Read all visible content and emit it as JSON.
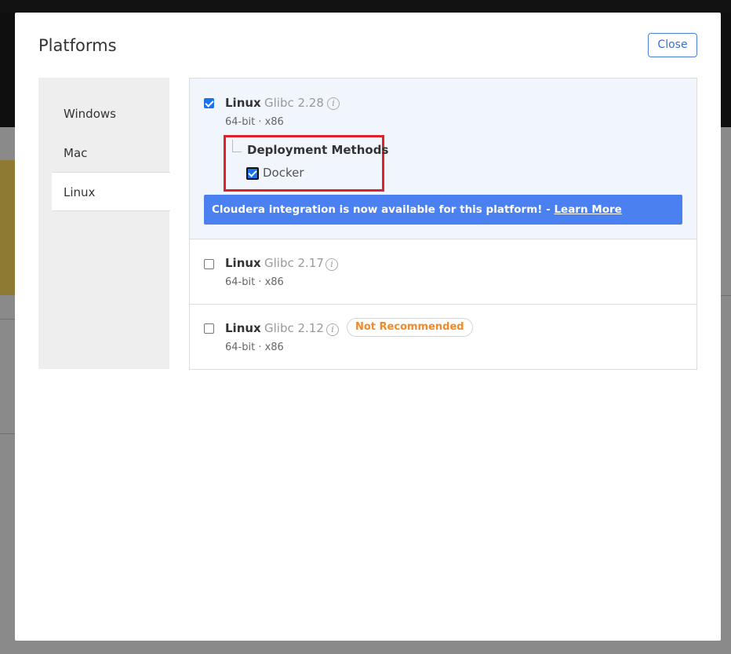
{
  "modal": {
    "title": "Platforms",
    "close_label": "Close"
  },
  "sidebar": {
    "items": [
      {
        "label": "Windows",
        "active": false
      },
      {
        "label": "Mac",
        "active": false
      },
      {
        "label": "Linux",
        "active": true
      }
    ]
  },
  "platforms": [
    {
      "name": "Linux",
      "version": "Glibc 2.28",
      "arch": "64-bit · x86",
      "checked": true,
      "deployment": {
        "title": "Deployment Methods",
        "methods": [
          {
            "label": "Docker",
            "checked": true
          }
        ]
      },
      "banner": {
        "text": "Cloudera integration is now available for this platform! - ",
        "link": "Learn More"
      }
    },
    {
      "name": "Linux",
      "version": "Glibc 2.17",
      "arch": "64-bit · x86",
      "checked": false
    },
    {
      "name": "Linux",
      "version": "Glibc 2.12",
      "arch": "64-bit · x86",
      "checked": false,
      "badge": "Not Recommended"
    }
  ],
  "colors": {
    "accent": "#4a80f0",
    "highlight_box": "#e0202a",
    "badge_text": "#f08a2c"
  }
}
